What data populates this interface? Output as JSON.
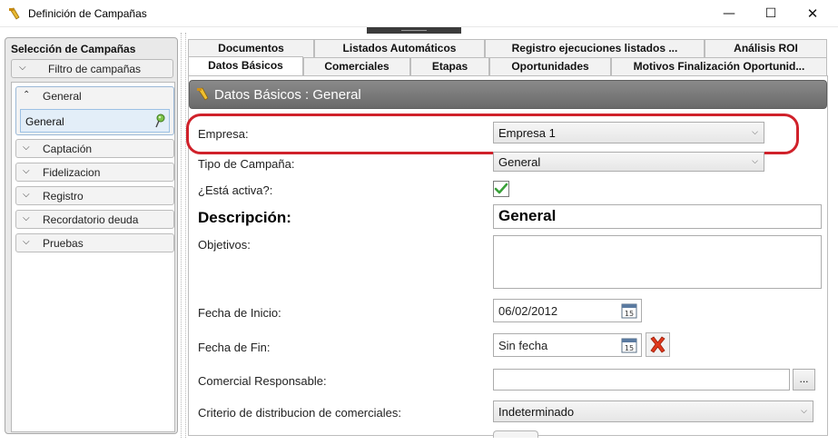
{
  "window": {
    "title": "Definición de Campañas",
    "minimize_glyph": "—",
    "maximize_glyph": "☐",
    "close_glyph": "✕"
  },
  "left_panel": {
    "title": "Selección de Campañas",
    "filter_label": "Filtro de campañas",
    "groups": [
      {
        "label": "General",
        "expanded": true,
        "items": [
          {
            "label": "General",
            "icon": "pin-icon"
          }
        ]
      },
      {
        "label": "Captación",
        "expanded": false
      },
      {
        "label": "Fidelizacion",
        "expanded": false
      },
      {
        "label": "Registro",
        "expanded": false
      },
      {
        "label": "Recordatorio deuda",
        "expanded": false
      },
      {
        "label": "Pruebas",
        "expanded": false
      }
    ]
  },
  "tabs": {
    "row1": [
      "Documentos",
      "Listados Automáticos",
      "Registro ejecuciones listados ...",
      "Análisis ROI"
    ],
    "row2": [
      "Datos Básicos",
      "Comerciales",
      "Etapas",
      "Oportunidades",
      "Motivos Finalización Oportunid..."
    ],
    "active": "Datos Básicos"
  },
  "section": {
    "title": "Datos Básicos : General"
  },
  "form": {
    "empresa": {
      "label": "Empresa:",
      "value": "Empresa 1"
    },
    "tipo_campana": {
      "label": "Tipo de Campaña:",
      "value": "General"
    },
    "activa": {
      "label": "¿Está activa?:",
      "checked": true
    },
    "descripcion": {
      "label": "Descripción:",
      "value": "General"
    },
    "objetivos": {
      "label": "Objetivos:",
      "value": ""
    },
    "fecha_inicio": {
      "label": "Fecha de Inicio:",
      "value": "06/02/2012",
      "calendar_day": "15"
    },
    "fecha_fin": {
      "label": "Fecha de Fin:",
      "value": "Sin fecha",
      "calendar_day": "15"
    },
    "comercial_responsable": {
      "label": "Comercial Responsable:",
      "value": "",
      "browse_label": "..."
    },
    "criterio_distribucion": {
      "label": "Criterio de distribucion de comerciales:",
      "value": "Indeterminado"
    }
  },
  "colors": {
    "highlight_ring": "#d0212a",
    "section_header": "#757575",
    "check": "#3aa13a",
    "delete": "#e0381c"
  }
}
